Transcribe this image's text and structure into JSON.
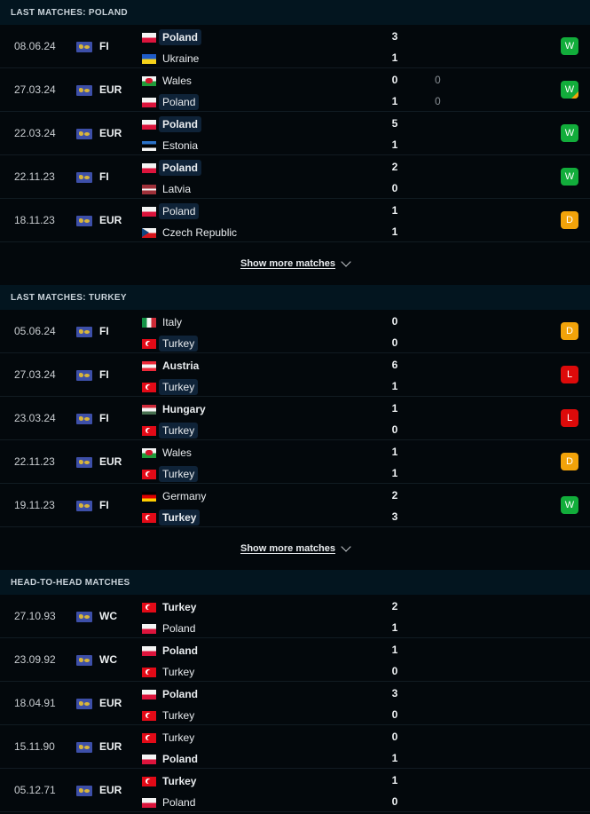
{
  "sections": [
    {
      "title": "LAST MATCHES: POLAND",
      "show_more": "Show more matches",
      "matches": [
        {
          "date": "08.06.24",
          "competition": "FI",
          "home": {
            "name": "Poland",
            "flag": "poland",
            "bold": true,
            "highlight": true
          },
          "away": {
            "name": "Ukraine",
            "flag": "ukraine",
            "bold": false,
            "highlight": false
          },
          "score_home": "3",
          "score_away": "1",
          "pen_home": "",
          "pen_away": "",
          "result": "W",
          "penalty_result": false
        },
        {
          "date": "27.03.24",
          "competition": "EUR",
          "home": {
            "name": "Wales",
            "flag": "wales",
            "bold": false,
            "highlight": false
          },
          "away": {
            "name": "Poland",
            "flag": "poland",
            "bold": false,
            "highlight": true
          },
          "score_home": "0",
          "score_away": "1",
          "pen_home": "0",
          "pen_away": "0",
          "result": "W",
          "penalty_result": true
        },
        {
          "date": "22.03.24",
          "competition": "EUR",
          "home": {
            "name": "Poland",
            "flag": "poland",
            "bold": true,
            "highlight": true
          },
          "away": {
            "name": "Estonia",
            "flag": "estonia",
            "bold": false,
            "highlight": false
          },
          "score_home": "5",
          "score_away": "1",
          "pen_home": "",
          "pen_away": "",
          "result": "W",
          "penalty_result": false
        },
        {
          "date": "22.11.23",
          "competition": "FI",
          "home": {
            "name": "Poland",
            "flag": "poland",
            "bold": true,
            "highlight": true
          },
          "away": {
            "name": "Latvia",
            "flag": "latvia",
            "bold": false,
            "highlight": false
          },
          "score_home": "2",
          "score_away": "0",
          "pen_home": "",
          "pen_away": "",
          "result": "W",
          "penalty_result": false
        },
        {
          "date": "18.11.23",
          "competition": "EUR",
          "home": {
            "name": "Poland",
            "flag": "poland",
            "bold": false,
            "highlight": true
          },
          "away": {
            "name": "Czech Republic",
            "flag": "czech",
            "bold": false,
            "highlight": false
          },
          "score_home": "1",
          "score_away": "1",
          "pen_home": "",
          "pen_away": "",
          "result": "D",
          "penalty_result": false
        }
      ]
    },
    {
      "title": "LAST MATCHES: TURKEY",
      "show_more": "Show more matches",
      "matches": [
        {
          "date": "05.06.24",
          "competition": "FI",
          "home": {
            "name": "Italy",
            "flag": "italy",
            "bold": false,
            "highlight": false
          },
          "away": {
            "name": "Turkey",
            "flag": "turkey",
            "bold": false,
            "highlight": true
          },
          "score_home": "0",
          "score_away": "0",
          "pen_home": "",
          "pen_away": "",
          "result": "D",
          "penalty_result": false
        },
        {
          "date": "27.03.24",
          "competition": "FI",
          "home": {
            "name": "Austria",
            "flag": "austria",
            "bold": true,
            "highlight": false
          },
          "away": {
            "name": "Turkey",
            "flag": "turkey",
            "bold": false,
            "highlight": true
          },
          "score_home": "6",
          "score_away": "1",
          "pen_home": "",
          "pen_away": "",
          "result": "L",
          "penalty_result": false
        },
        {
          "date": "23.03.24",
          "competition": "FI",
          "home": {
            "name": "Hungary",
            "flag": "hungary",
            "bold": true,
            "highlight": false
          },
          "away": {
            "name": "Turkey",
            "flag": "turkey",
            "bold": false,
            "highlight": true
          },
          "score_home": "1",
          "score_away": "0",
          "pen_home": "",
          "pen_away": "",
          "result": "L",
          "penalty_result": false
        },
        {
          "date": "22.11.23",
          "competition": "EUR",
          "home": {
            "name": "Wales",
            "flag": "wales",
            "bold": false,
            "highlight": false
          },
          "away": {
            "name": "Turkey",
            "flag": "turkey",
            "bold": false,
            "highlight": true
          },
          "score_home": "1",
          "score_away": "1",
          "pen_home": "",
          "pen_away": "",
          "result": "D",
          "penalty_result": false
        },
        {
          "date": "19.11.23",
          "competition": "FI",
          "home": {
            "name": "Germany",
            "flag": "germany",
            "bold": false,
            "highlight": false
          },
          "away": {
            "name": "Turkey",
            "flag": "turkey",
            "bold": true,
            "highlight": true
          },
          "score_home": "2",
          "score_away": "3",
          "pen_home": "",
          "pen_away": "",
          "result": "W",
          "penalty_result": false
        }
      ]
    },
    {
      "title": "HEAD-TO-HEAD MATCHES",
      "show_more": "",
      "matches": [
        {
          "date": "27.10.93",
          "competition": "WC",
          "home": {
            "name": "Turkey",
            "flag": "turkey",
            "bold": true,
            "highlight": false
          },
          "away": {
            "name": "Poland",
            "flag": "poland",
            "bold": false,
            "highlight": false
          },
          "score_home": "2",
          "score_away": "1",
          "pen_home": "",
          "pen_away": "",
          "result": "",
          "penalty_result": false
        },
        {
          "date": "23.09.92",
          "competition": "WC",
          "home": {
            "name": "Poland",
            "flag": "poland",
            "bold": true,
            "highlight": false
          },
          "away": {
            "name": "Turkey",
            "flag": "turkey",
            "bold": false,
            "highlight": false
          },
          "score_home": "1",
          "score_away": "0",
          "pen_home": "",
          "pen_away": "",
          "result": "",
          "penalty_result": false
        },
        {
          "date": "18.04.91",
          "competition": "EUR",
          "home": {
            "name": "Poland",
            "flag": "poland",
            "bold": true,
            "highlight": false
          },
          "away": {
            "name": "Turkey",
            "flag": "turkey",
            "bold": false,
            "highlight": false
          },
          "score_home": "3",
          "score_away": "0",
          "pen_home": "",
          "pen_away": "",
          "result": "",
          "penalty_result": false
        },
        {
          "date": "15.11.90",
          "competition": "EUR",
          "home": {
            "name": "Turkey",
            "flag": "turkey",
            "bold": false,
            "highlight": false
          },
          "away": {
            "name": "Poland",
            "flag": "poland",
            "bold": true,
            "highlight": false
          },
          "score_home": "0",
          "score_away": "1",
          "pen_home": "",
          "pen_away": "",
          "result": "",
          "penalty_result": false
        },
        {
          "date": "05.12.71",
          "competition": "EUR",
          "home": {
            "name": "Turkey",
            "flag": "turkey",
            "bold": true,
            "highlight": false
          },
          "away": {
            "name": "Poland",
            "flag": "poland",
            "bold": false,
            "highlight": false
          },
          "score_home": "1",
          "score_away": "0",
          "pen_home": "",
          "pen_away": "",
          "result": "",
          "penalty_result": false
        }
      ]
    }
  ]
}
